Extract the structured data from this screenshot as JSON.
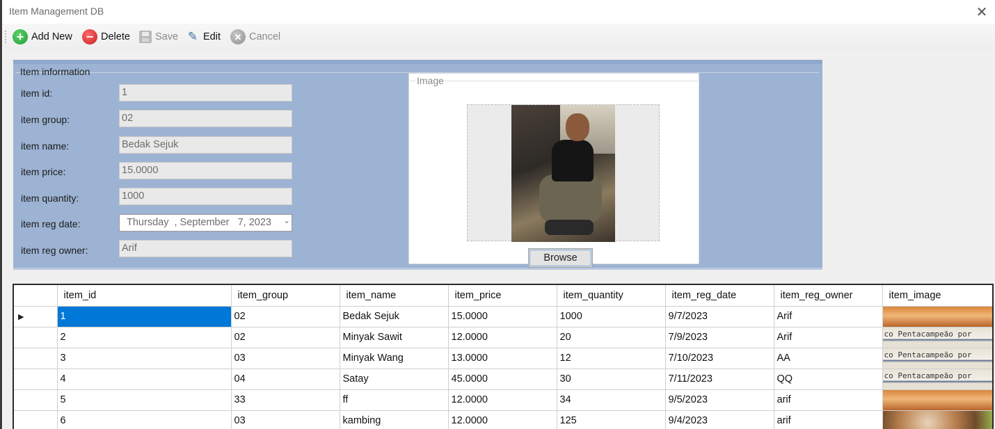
{
  "window": {
    "title": "Item Management DB",
    "close_glyph": "✕"
  },
  "toolbar": {
    "add_label": "Add New",
    "delete_label": "Delete",
    "save_label": "Save",
    "edit_label": "Edit",
    "cancel_label": "Cancel",
    "icons": {
      "add": "plus-circle-icon",
      "delete": "minus-circle-icon",
      "save": "floppy-icon",
      "edit": "edit-icon",
      "cancel": "x-circle-icon"
    }
  },
  "item_info": {
    "legend": "Item information",
    "fields": [
      {
        "label": "item id:",
        "value": "1"
      },
      {
        "label": "item group:",
        "value": "02"
      },
      {
        "label": "item name:",
        "value": "Bedak Sejuk"
      },
      {
        "label": "item price:",
        "value": "15.0000"
      },
      {
        "label": "item quantity:",
        "value": "1000"
      },
      {
        "label": "item reg date:",
        "value": "Thursday  , September   7, 2023"
      },
      {
        "label": "item reg owner:",
        "value": "Arif"
      }
    ]
  },
  "image_panel": {
    "legend": "Image",
    "browse_label": "Browse"
  },
  "grid": {
    "columns": [
      "item_id",
      "item_group",
      "item_name",
      "item_price",
      "item_quantity",
      "item_reg_date",
      "item_reg_owner",
      "item_image"
    ],
    "current_row_marker": "▶",
    "rows": [
      {
        "id": "1",
        "group": "02",
        "name": "Bedak Sejuk",
        "price": "15.0000",
        "quantity": "1000",
        "reg_date": "9/7/2023",
        "owner": "Arif",
        "image_text": ""
      },
      {
        "id": "2",
        "group": "02",
        "name": "Minyak Sawit",
        "price": "12.0000",
        "quantity": "20",
        "reg_date": "7/9/2023",
        "owner": "Arif",
        "image_text": "co Pentacampeão por"
      },
      {
        "id": "3",
        "group": "03",
        "name": "Minyak Wang",
        "price": "13.0000",
        "quantity": "12",
        "reg_date": "7/10/2023",
        "owner": "AA",
        "image_text": "co Pentacampeão por"
      },
      {
        "id": "4",
        "group": "04",
        "name": "Satay",
        "price": "45.0000",
        "quantity": "30",
        "reg_date": "7/11/2023",
        "owner": "QQ",
        "image_text": "co Pentacampeão por"
      },
      {
        "id": "5",
        "group": "33",
        "name": "ff",
        "price": "12.0000",
        "quantity": "34",
        "reg_date": "9/5/2023",
        "owner": "arif",
        "image_text": ""
      },
      {
        "id": "6",
        "group": "03",
        "name": "kambing",
        "price": "12.0000",
        "quantity": "125",
        "reg_date": "9/4/2023",
        "owner": "arif",
        "image_text": ""
      }
    ]
  }
}
